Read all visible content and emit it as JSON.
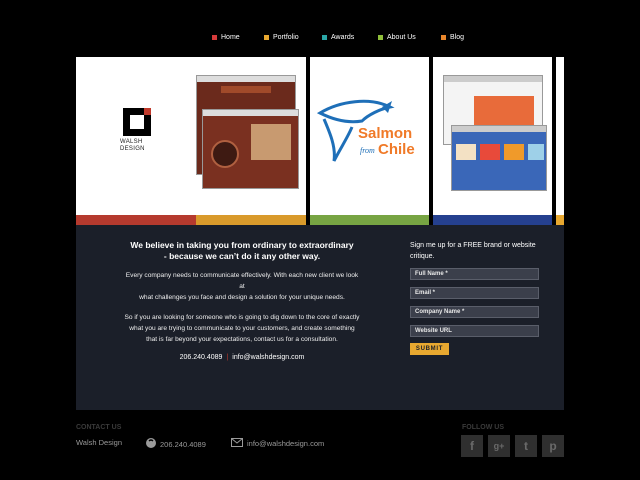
{
  "nav": {
    "items": [
      {
        "label": "Home",
        "color": "#d63b3b"
      },
      {
        "label": "Portfolio",
        "color": "#e8a830"
      },
      {
        "label": "Awards",
        "color": "#2aa6a6"
      },
      {
        "label": "About Us",
        "color": "#8fbf3a"
      },
      {
        "label": "Blog",
        "color": "#e8862b"
      }
    ]
  },
  "slider": {
    "walsh_logo_text": "WALSH DESIGN",
    "salmon_logo_line1": "Salmon",
    "salmon_logo_from": "from",
    "salmon_logo_line2": "Chile",
    "stripe_colors": [
      "#b53a2e",
      "#d99a2b",
      "#77a443",
      "#25408f",
      "#e8a830"
    ]
  },
  "content": {
    "headline_line1": "We believe in taking you from ordinary to extraordinary",
    "headline_line2": "- because we can’t do it any other way.",
    "para1_line1": "Every company needs to communicate effectively.  With each new client we look",
    "para1_line2": "at",
    "para1_line3": "what challenges you face and design a solution for your unique needs.",
    "para2_line1": "So if you are looking for someone who is going to dig down to the core of exactly",
    "para2_line2": "what you are trying to communicate to your customers, and create something",
    "para2_line3": "that is far beyond your expectations, contact us for a consultation.",
    "phone": "206.240.4089",
    "separator": "|",
    "email": "info@walshdesign.com"
  },
  "signup": {
    "title_line1": "Sign me up for a FREE brand or website",
    "title_line2": "critique.",
    "full_name_placeholder": "Full Name *",
    "email_placeholder": "Email *",
    "company_placeholder": "Company Name *",
    "website_placeholder": "Website URL",
    "submit_label": "SUBMIT"
  },
  "footer": {
    "contact_title": "CONTACT US",
    "company": "Walsh Design",
    "phone": "206.240.4089",
    "email": "info@walshdesign.com",
    "follow_title": "FOLLOW US",
    "social": [
      "f",
      "g+",
      "t",
      "p"
    ]
  }
}
